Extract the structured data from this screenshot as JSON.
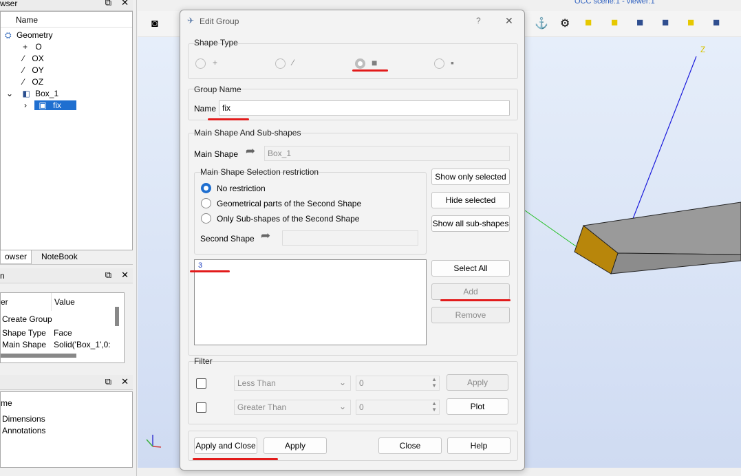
{
  "left_panel": {
    "browser_title": "wser",
    "tree_header": "Name",
    "tree": [
      {
        "label": "Geometry"
      },
      {
        "label": "O"
      },
      {
        "label": "OX"
      },
      {
        "label": "OY"
      },
      {
        "label": "OZ"
      },
      {
        "label": "Box_1"
      },
      {
        "label": "fix"
      }
    ],
    "tabs": [
      "owser",
      "NoteBook"
    ],
    "props_title": "n",
    "props_header": {
      "name": "er",
      "value": "Value"
    },
    "props_rows": [
      {
        "name": "Create Group",
        "value": ""
      },
      {
        "name": "Shape Type",
        "value": "Face"
      },
      {
        "name": "Main Shape",
        "value": "Solid('Box_1',0:"
      }
    ],
    "bottom_header": "me",
    "bottom_items": [
      "Dimensions",
      "Annotations"
    ]
  },
  "viewer": {
    "status": "OCC scene:1 - viewer:1",
    "axis_label": "Z"
  },
  "dialog": {
    "title": "Edit Group",
    "help_char": "?",
    "close_char": "✕",
    "shape_type_title": "Shape Type",
    "shape_types": [
      "+",
      "⁄",
      "■",
      "▪"
    ],
    "selected_shape_type": 2,
    "group_name_title": "Group Name",
    "name_label": "Name",
    "name_value": "fix",
    "main_shape_group_title": "Main Shape And Sub-shapes",
    "main_shape_label": "Main Shape",
    "main_shape_value": "Box_1",
    "restriction_title": "Main Shape Selection restriction",
    "restrictions": [
      "No restriction",
      "Geometrical parts of the Second Shape",
      "Only Sub-shapes of the Second Shape"
    ],
    "selected_restriction": 0,
    "second_shape_label": "Second Shape",
    "second_shape_value": "",
    "btn_show_only": "Show only selected",
    "btn_hide": "Hide selected",
    "btn_show_all": "Show all sub-shapes",
    "id_list": [
      "3"
    ],
    "btn_select_all": "Select All",
    "btn_add": "Add",
    "btn_remove": "Remove",
    "filter_title": "Filter",
    "filter_rows": [
      {
        "combo": "Less Than",
        "value": "0",
        "button": "Apply"
      },
      {
        "combo": "Greater Than",
        "value": "0",
        "button": "Plot"
      }
    ],
    "btn_apply_close": "Apply and Close",
    "btn_apply": "Apply",
    "btn_close": "Close",
    "btn_help": "Help"
  },
  "colors": {
    "accent": "#1f6fd0",
    "selection": "#1f6fd0",
    "annotation_red": "#e21b1b",
    "box_front": "#b8860b",
    "box_side": "#9a9a9a"
  }
}
